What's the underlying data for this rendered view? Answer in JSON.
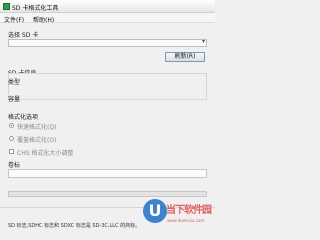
{
  "window": {
    "title": "SD 卡格式化工具"
  },
  "menu": {
    "items": [
      "文件(F)",
      "帮助(H)"
    ]
  },
  "select_card": {
    "label": "选择 SD 卡",
    "value": ""
  },
  "refresh_button": {
    "label": "刷新(R)"
  },
  "card_info": {
    "title": "SD 卡信息",
    "type_label": "类型",
    "capacity_label": "容量"
  },
  "format_options": {
    "title": "格式化选项",
    "quick": "快速格式化(Q)",
    "overwrite": "覆盖格式化(O)",
    "chs": "CHS 格式化大小调整"
  },
  "volume": {
    "label": "卷标",
    "value": ""
  },
  "status": {
    "text": "SD 标志,SDHC 标志和 SDXC 标志是 SD-3C,LLC 的商标。"
  },
  "watermark": {
    "glyph": "U",
    "text": "当下软件园",
    "url": "www.downxia.com"
  }
}
